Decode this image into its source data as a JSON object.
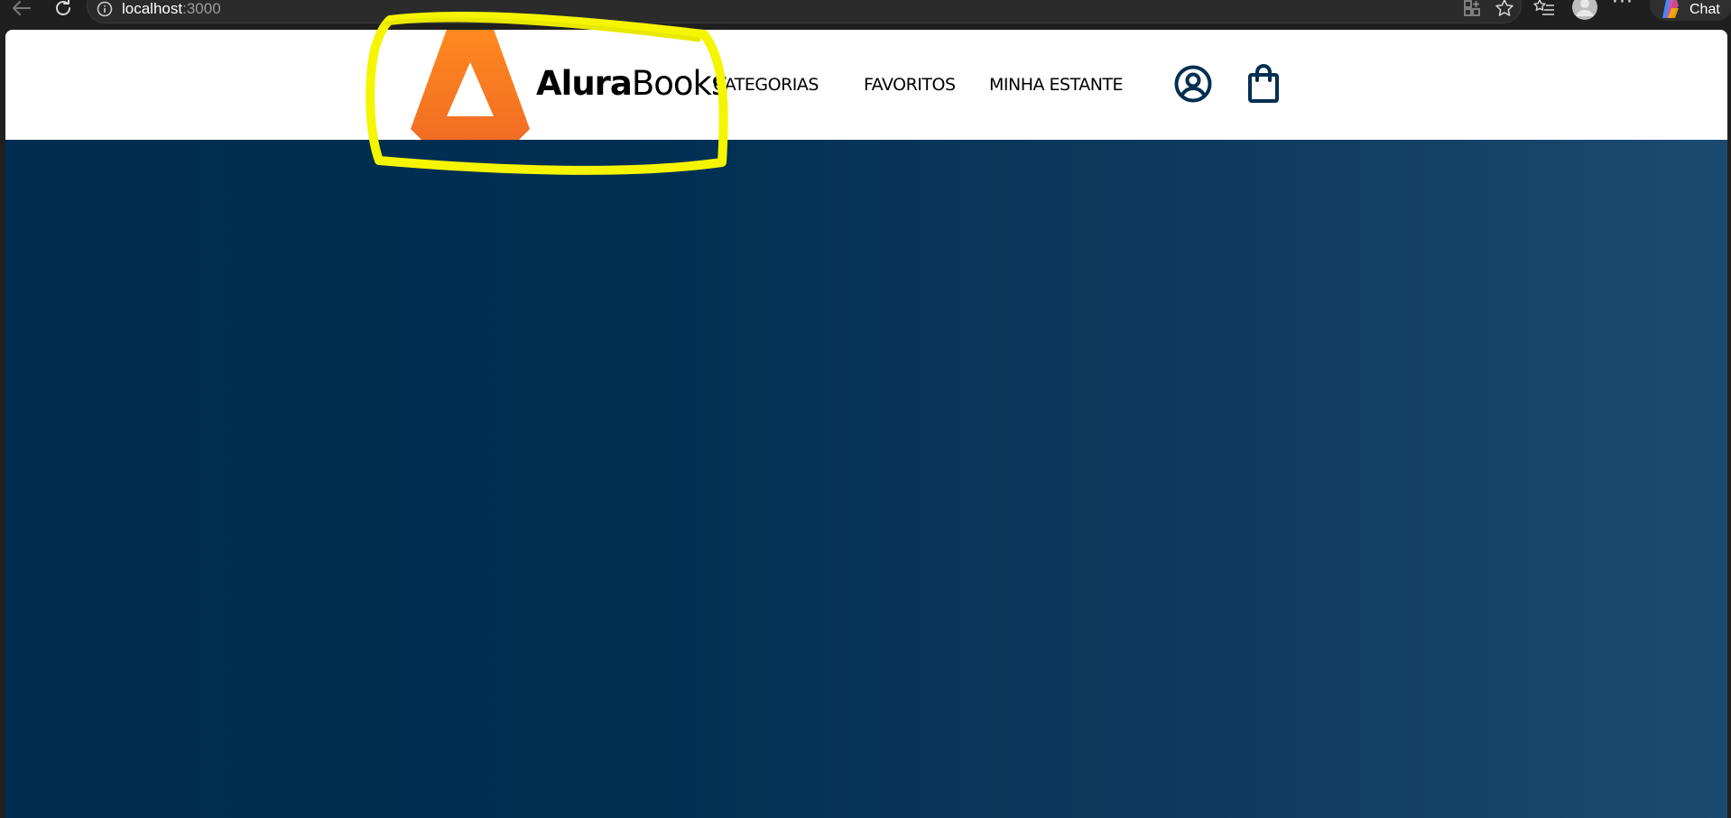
{
  "browser": {
    "url_host": "localhost",
    "url_port": ":3000",
    "chat_label": "Chat"
  },
  "site": {
    "logo_bold": "Alura",
    "logo_light": "Books",
    "nav": [
      {
        "label": "CATEGORIAS"
      },
      {
        "label": "FAVORITOS"
      },
      {
        "label": "MINHA ESTANTE"
      }
    ]
  },
  "colors": {
    "logo_orange": "#f7801f",
    "icon_navy": "#002f52",
    "hero_navy": "#002f52",
    "annotation_yellow": "#f5f500"
  },
  "icons": {
    "profile": "user-circle-icon",
    "bag": "shopping-bag-icon"
  }
}
